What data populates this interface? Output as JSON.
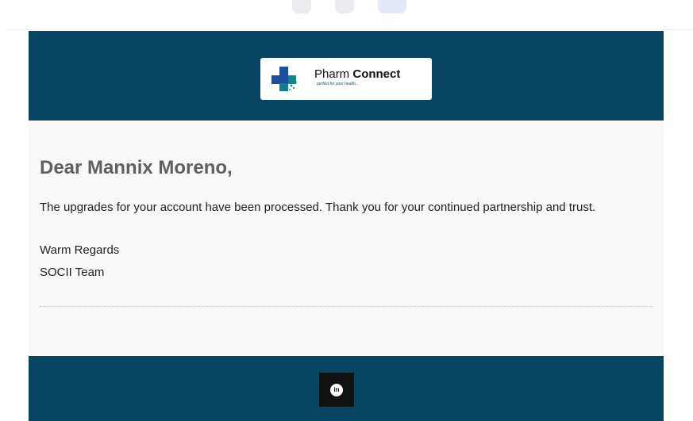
{
  "toolbar": {
    "icons": [
      "toolbar-button-1",
      "toolbar-button-2",
      "toolbar-button-active"
    ]
  },
  "logo": {
    "name_prefix": "Pharm ",
    "name_bold": "Connect",
    "tagline": "perfect for your health..."
  },
  "email": {
    "greeting": "Dear Mannix Moreno,",
    "message": "The upgrades for your account have been processed. Thank you for your continued partnership and trust.",
    "signoff": "Warm Regards",
    "team": "SOCII Team"
  },
  "footer": {
    "social": {
      "linkedin_icon": "linkedin-icon",
      "linkedin_glyph": "in"
    }
  },
  "colors": {
    "header_footer": "#074563",
    "content_background": "#faf9f7",
    "body_text": "#1f1f1f",
    "greeting_text": "#5f5f5f",
    "logo_blue": "#1c4f9d",
    "logo_teal": "#0b8f8a",
    "linkedin_button": "#111111"
  }
}
